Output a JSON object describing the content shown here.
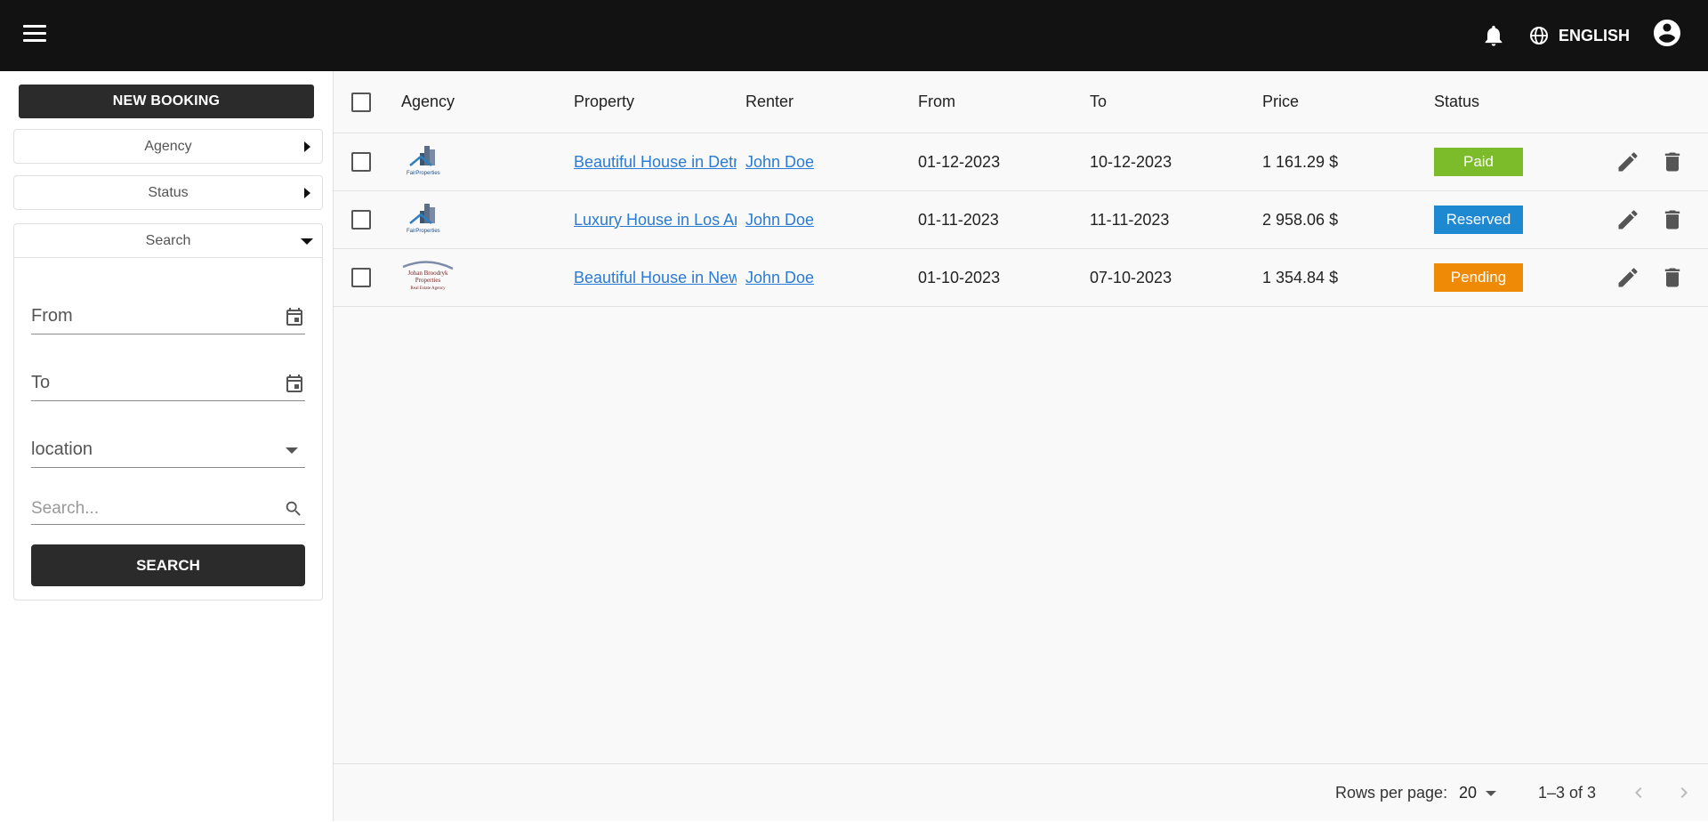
{
  "topbar": {
    "language": "ENGLISH"
  },
  "sidebar": {
    "new_booking_label": "NEW BOOKING",
    "agency_label": "Agency",
    "status_label": "Status",
    "search_label": "Search",
    "from_label": "From",
    "to_label": "To",
    "location_label": "location",
    "search_placeholder": "Search...",
    "search_button": "SEARCH"
  },
  "table": {
    "headers": {
      "agency": "Agency",
      "property": "Property",
      "renter": "Renter",
      "from": "From",
      "to": "To",
      "price": "Price",
      "status": "Status"
    },
    "rows": [
      {
        "agency_logo": "FairProperties",
        "property": "Beautiful House in Detroit",
        "renter": "John Doe",
        "from": "01-12-2023",
        "to": "10-12-2023",
        "price": "1 161.29 $",
        "status": "Paid",
        "status_color": "#7cbb2a"
      },
      {
        "agency_logo": "FairProperties",
        "property": "Luxury House in Los Angeles",
        "renter": "John Doe",
        "from": "01-11-2023",
        "to": "11-11-2023",
        "price": "2 958.06 $",
        "status": "Reserved",
        "status_color": "#1e88d0"
      },
      {
        "agency_logo": "Johan Broodryk Properties Real Estate Agency",
        "property": "Beautiful House in New York",
        "renter": "John Doe",
        "from": "01-10-2023",
        "to": "07-10-2023",
        "price": "1 354.84 $",
        "status": "Pending",
        "status_color": "#ef8a07"
      }
    ]
  },
  "pagination": {
    "rows_per_page_label": "Rows per page:",
    "rows_per_page": "20",
    "range": "1–3 of 3"
  },
  "colors": {
    "topbar": "#121212",
    "button": "#2b2b2b",
    "link": "#2a7bd1"
  }
}
